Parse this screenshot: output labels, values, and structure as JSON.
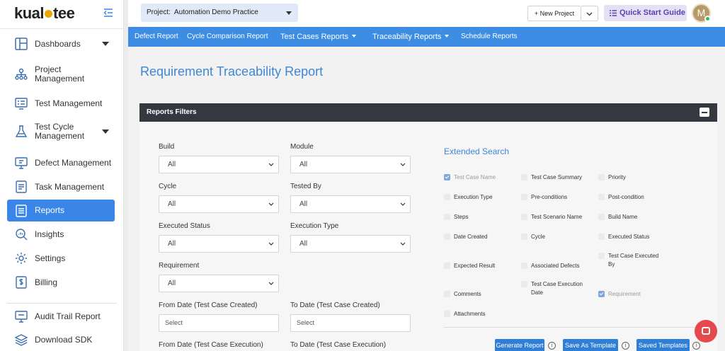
{
  "brand": {
    "logo_left": "kual",
    "logo_right": "tee",
    "logo_accent": "#e8a800"
  },
  "sidebar": {
    "items": [
      {
        "label": "Dashboards",
        "icon": "dashboard-icon",
        "caret": true
      },
      {
        "label": "Project\nManagement",
        "icon": "project-tree-icon"
      },
      {
        "label": "Test Management",
        "icon": "test-list-icon"
      },
      {
        "label": "Test Cycle\nManagement",
        "icon": "flask-icon",
        "caret": true
      },
      {
        "label": "Defect Management",
        "icon": "bug-monitor-icon"
      },
      {
        "label": "Task Management",
        "icon": "task-list-icon"
      },
      {
        "label": "Reports",
        "icon": "reports-icon",
        "active": true
      },
      {
        "label": "Insights",
        "icon": "insights-search-icon"
      },
      {
        "label": "Settings",
        "icon": "gear-icon"
      },
      {
        "label": "Billing",
        "icon": "billing-dollar-icon"
      },
      {
        "label": "Audit Trail Report",
        "icon": "audit-monitor-icon"
      },
      {
        "label": "Download SDK",
        "icon": "layers-icon"
      }
    ],
    "active_color": "#3a86e8"
  },
  "topbar": {
    "project_label": "Project:",
    "project_value": "Automation Demo Practice",
    "new_project": "+ New Project",
    "quick_start": "Quick Start Guide",
    "avatar_initial": "M"
  },
  "tabs": [
    {
      "label": "Defect Report"
    },
    {
      "label": "Cycle Comparison Report"
    },
    {
      "label": "Test Cases Reports",
      "dropdown": true
    },
    {
      "label": "Traceability Reports",
      "dropdown": true
    },
    {
      "label": "Schedule Reports"
    }
  ],
  "page": {
    "title": "Requirement Traceability Report"
  },
  "filters": {
    "header": "Reports Filters",
    "fields": {
      "build": {
        "label": "Build",
        "value": "All"
      },
      "module": {
        "label": "Module",
        "value": "All"
      },
      "cycle": {
        "label": "Cycle",
        "value": "All"
      },
      "tested_by": {
        "label": "Tested By",
        "value": "All"
      },
      "executed_status": {
        "label": "Executed Status",
        "value": "All"
      },
      "execution_type": {
        "label": "Execution Type",
        "value": "All"
      },
      "requirement": {
        "label": "Requirement",
        "value": "All"
      },
      "from_date_created": {
        "label": "From Date (Test Case Created)",
        "placeholder": "Select"
      },
      "to_date_created": {
        "label": "To Date (Test Case Created)",
        "placeholder": "Select"
      },
      "from_date_execution": {
        "label": "From Date (Test Case Execution)"
      },
      "to_date_execution": {
        "label": "To Date (Test Case Execution)"
      }
    }
  },
  "extended_search": {
    "title": "Extended Search",
    "options": [
      {
        "label": "Test Case Name",
        "checked": true,
        "disabled": true
      },
      {
        "label": "Test Case Summary",
        "checked": false
      },
      {
        "label": "Priority",
        "checked": false
      },
      {
        "label": "Execution Type",
        "checked": false
      },
      {
        "label": "Pre-conditions",
        "checked": false
      },
      {
        "label": "Post-condition",
        "checked": false
      },
      {
        "label": "Steps",
        "checked": false
      },
      {
        "label": "Test Scenario Name",
        "checked": false
      },
      {
        "label": "Build Name",
        "checked": false
      },
      {
        "label": "Date Created",
        "checked": false
      },
      {
        "label": "Cycle",
        "checked": false
      },
      {
        "label": "Executed Status",
        "checked": false
      },
      {
        "label": "Expected Result",
        "checked": false
      },
      {
        "label": "Associated Defects",
        "checked": false
      },
      {
        "label": "Test Case Executed By",
        "checked": false
      },
      {
        "label": "Comments",
        "checked": false
      },
      {
        "label": "Test Case Execution Date",
        "checked": false
      },
      {
        "label": "Requirement",
        "checked": true,
        "disabled": true
      },
      {
        "label": "Attachments",
        "checked": false
      }
    ]
  },
  "actions": {
    "generate": "Generate Report",
    "save_template": "Save As Template",
    "saved_templates": "Saved Templates",
    "info": "i"
  }
}
